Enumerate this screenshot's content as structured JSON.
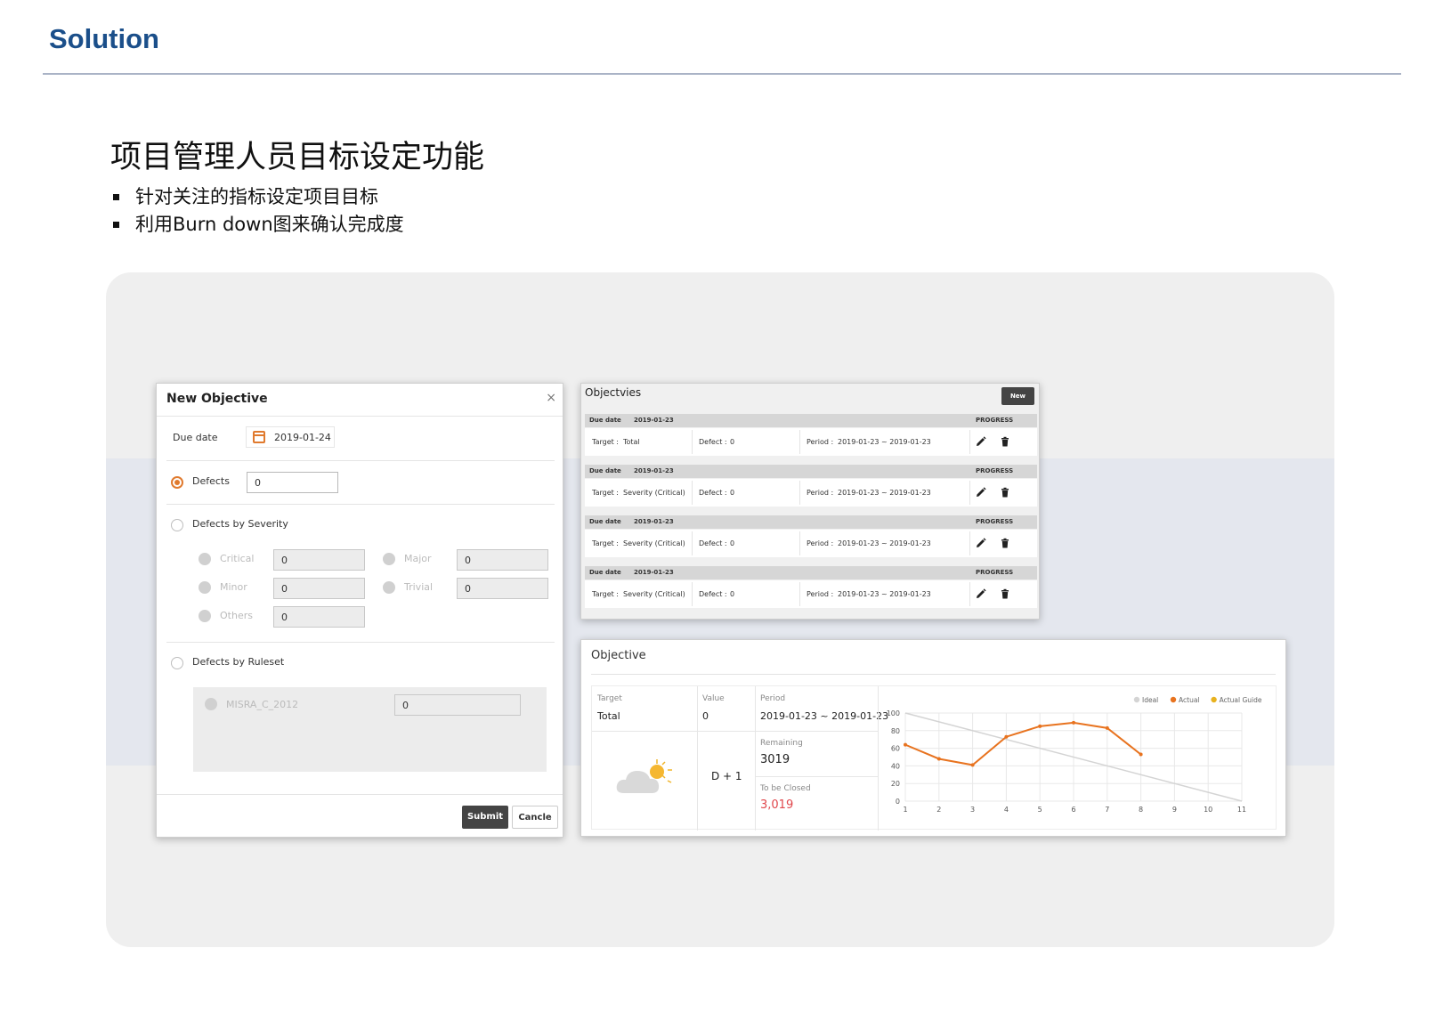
{
  "header": {
    "title": "Solution"
  },
  "section": {
    "title": "项目管理人员目标设定功能",
    "bullets": [
      "针对关注的指标设定项目目标",
      "利用Burn down图来确认完成度"
    ]
  },
  "new_objective": {
    "title": "New Objective",
    "close": "×",
    "due_date_label": "Due date",
    "due_date_value": "2019-01-24",
    "defects_label": "Defects",
    "defects_value": "0",
    "by_severity_label": "Defects by Severity",
    "severity": {
      "critical_label": "Critical",
      "critical_value": "0",
      "major_label": "Major",
      "major_value": "0",
      "minor_label": "Minor",
      "minor_value": "0",
      "trivial_label": "Trivial",
      "trivial_value": "0",
      "others_label": "Others",
      "others_value": "0"
    },
    "by_ruleset_label": "Defects by Ruleset",
    "ruleset_name": "MISRA_C_2012",
    "ruleset_value": "0",
    "submit_label": "Submit",
    "cancel_label": "Cancle"
  },
  "objectives_list": {
    "title": "Objectvies",
    "new_label": "New",
    "due_label": "Due date",
    "progress_label": "PROGRESS",
    "target_label": "Target :",
    "defect_label": "Defect :",
    "period_label": "Period :",
    "rows": [
      {
        "due": "2019-01-23",
        "target": "Total",
        "defect": "0",
        "period": "2019-01-23 ~ 2019-01-23"
      },
      {
        "due": "2019-01-23",
        "target": "Severity (Critical)",
        "defect": "0",
        "period": "2019-01-23 ~ 2019-01-23"
      },
      {
        "due": "2019-01-23",
        "target": "Severity (Critical)",
        "defect": "0",
        "period": "2019-01-23 ~ 2019-01-23"
      },
      {
        "due": "2019-01-23",
        "target": "Severity (Critical)",
        "defect": "0",
        "period": "2019-01-23 ~ 2019-01-23"
      }
    ],
    "icons": [
      "pencil-icon",
      "trash-icon"
    ]
  },
  "objective_detail": {
    "title": "Objective",
    "target_label": "Target",
    "target_value": "Total",
    "value_label": "Value",
    "value_value": "0",
    "period_label": "Period",
    "period_value": "2019-01-23 ~ 2019-01-23",
    "dday": "D + 1",
    "remaining_label": "Remaining",
    "remaining_value": "3019",
    "to_be_closed_label": "To be Closed",
    "to_be_closed_value": "3,019",
    "weather_icon": "partly-cloudy-icon"
  },
  "chart_data": {
    "type": "line",
    "x": [
      1,
      2,
      3,
      4,
      5,
      6,
      7,
      8,
      9,
      10,
      11
    ],
    "ylim": [
      0,
      100
    ],
    "yticks": [
      0,
      20,
      40,
      60,
      80,
      100
    ],
    "grid": true,
    "legend_position": "top-right",
    "series": [
      {
        "name": "Ideal",
        "color": "#d4d4d4",
        "x": [
          1,
          11
        ],
        "values": [
          100,
          0
        ]
      },
      {
        "name": "Actual",
        "color": "#e8731f",
        "x": [
          1,
          2,
          3,
          4,
          5,
          6,
          7,
          8
        ],
        "values": [
          64,
          48,
          41,
          73,
          85,
          89,
          83,
          53
        ]
      },
      {
        "name": "Actual Guide",
        "color": "#e8b21f",
        "x": [],
        "values": []
      }
    ]
  },
  "colors": {
    "accent": "#e07a2e",
    "title_blue": "#1b4f8a",
    "danger": "#e0474c"
  }
}
